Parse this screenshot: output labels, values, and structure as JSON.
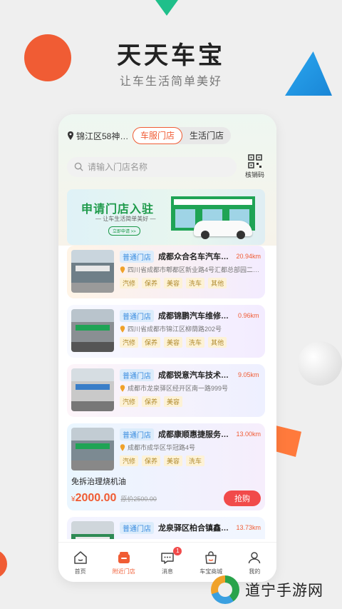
{
  "hero": {
    "title": "天天车宝",
    "subtitle": "让车生活简单美好"
  },
  "header": {
    "location": "锦江区58神…",
    "segments": [
      {
        "label": "车服门店",
        "active": true
      },
      {
        "label": "生活门店",
        "active": false
      }
    ],
    "search_placeholder": "请输入门店名称",
    "qr_label": "核销码"
  },
  "banner": {
    "title": "申请门店入驻",
    "subtitle": "— 让车生活简单美好 —",
    "button": "立即申请 >>"
  },
  "stores": [
    {
      "badge": "普通门店",
      "name": "成都众合名车汽车服…",
      "distance": "20.94km",
      "address": "四川省成都市郫都区新业路4号汇都总部园二…",
      "tags": [
        "汽修",
        "保养",
        "美容",
        "洗车",
        "其他"
      ]
    },
    {
      "badge": "普通门店",
      "name": "成都锦鹏汽车维修服…",
      "distance": "0.96km",
      "address": "四川省成都市锦江区柳荫路202号",
      "tags": [
        "汽修",
        "保养",
        "美容",
        "洗车",
        "其他"
      ]
    },
    {
      "badge": "普通门店",
      "name": "成都锐意汽车技术服…",
      "distance": "9.05km",
      "address": "成都市龙泉驿区经开区南一路999号",
      "tags": [
        "汽修",
        "保养",
        "美容"
      ]
    },
    {
      "badge": "普通门店",
      "name": "成都康顺惠捷服务有…",
      "distance": "13.00km",
      "address": "成都市成华区华冠路4号",
      "tags": [
        "汽修",
        "保养",
        "美容",
        "洗车"
      ],
      "promo": {
        "name": "免拆治理烧机油",
        "currency": "¥",
        "price": "2000.00",
        "original": "原价2500.00",
        "button": "抢购"
      }
    },
    {
      "badge": "普通门店",
      "name": "龙泉驿区柏合镇鑫龙…",
      "distance": "13.73km"
    }
  ],
  "tabbar": [
    {
      "label": "首页",
      "icon": "home-icon",
      "active": false
    },
    {
      "label": "附近门店",
      "icon": "store-icon",
      "active": true
    },
    {
      "label": "消息",
      "icon": "message-icon",
      "active": false,
      "badge": "1"
    },
    {
      "label": "车宝商城",
      "icon": "shop-bag-icon",
      "active": false
    },
    {
      "label": "我的",
      "icon": "user-icon",
      "active": false
    }
  ],
  "watermark": {
    "text": "道宁手游网"
  },
  "colors": {
    "accent": "#f05c34",
    "brand_green": "#1d9a4a",
    "badge_blue": "#3a8de0"
  }
}
